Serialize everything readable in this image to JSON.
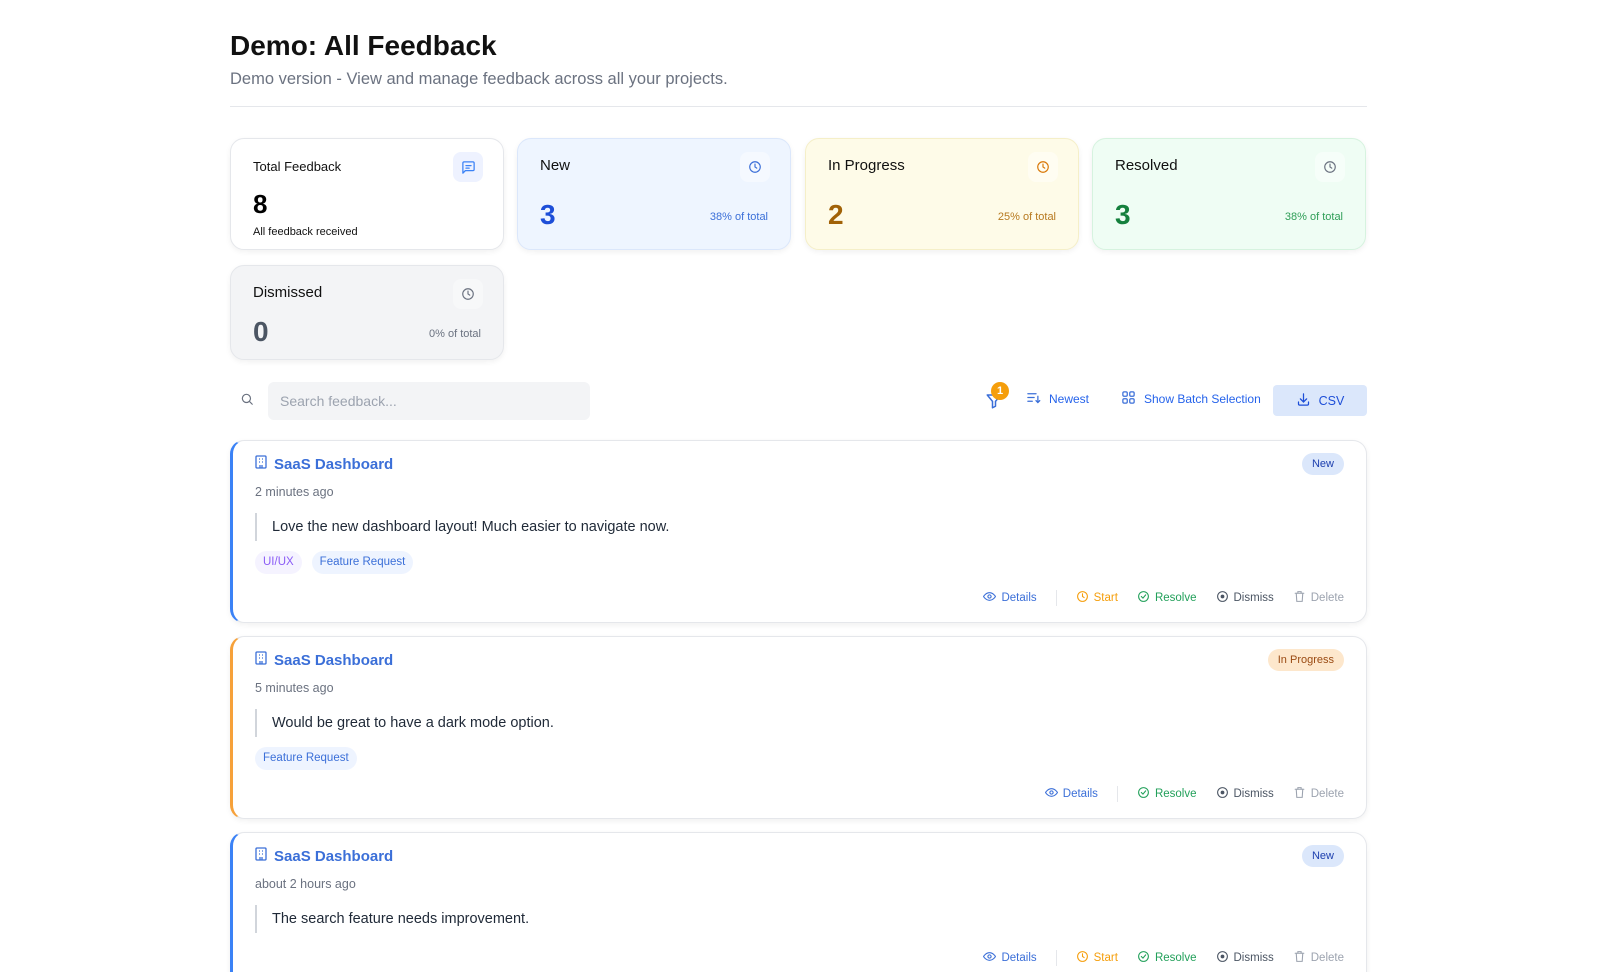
{
  "header": {
    "title": "Demo: All Feedback",
    "subtitle": "Demo version - View and manage feedback across all your projects."
  },
  "stats": {
    "total": {
      "label": "Total Feedback",
      "value": "8",
      "sub": "All feedback received"
    },
    "new": {
      "label": "New",
      "value": "3",
      "pct": "38% of total"
    },
    "in_progress": {
      "label": "In Progress",
      "value": "2",
      "pct": "25% of total"
    },
    "resolved": {
      "label": "Resolved",
      "value": "3",
      "pct": "38% of total"
    },
    "dismissed": {
      "label": "Dismissed",
      "value": "0",
      "pct": "0% of total"
    }
  },
  "toolbar": {
    "search_placeholder": "Search feedback...",
    "filter_count": "1",
    "sort_label": "Newest",
    "batch_label": "Show Batch Selection",
    "csv_label": "CSV"
  },
  "actions": {
    "details": "Details",
    "start": "Start",
    "resolve": "Resolve",
    "dismiss": "Dismiss",
    "delete": "Delete"
  },
  "feedback": [
    {
      "project": "SaaS Dashboard",
      "time": "2 minutes ago",
      "text": "Love the new dashboard layout! Much easier to navigate now.",
      "status": "New",
      "tags": [
        "UI/UX",
        "Feature Request"
      ]
    },
    {
      "project": "SaaS Dashboard",
      "time": "5 minutes ago",
      "text": "Would be great to have a dark mode option.",
      "status": "In Progress",
      "tags": [
        "Feature Request"
      ]
    },
    {
      "project": "SaaS Dashboard",
      "time": "about 2 hours ago",
      "text": "The search feature needs improvement.",
      "status": "New",
      "tags": []
    }
  ],
  "colors": {
    "accent": "#3b6fd8",
    "new": "#1d4ed8",
    "in_progress": "#a16207",
    "resolved": "#15803d",
    "dismissed": "#4b5563",
    "badge_orange": "#f59e0b"
  },
  "icons": {
    "total": "message-square-icon",
    "status": "clock-icon",
    "search": "search-icon",
    "filter": "filter-icon",
    "sort": "sort-icon",
    "batch": "grid-icon",
    "csv": "download-icon",
    "project": "building-icon"
  }
}
